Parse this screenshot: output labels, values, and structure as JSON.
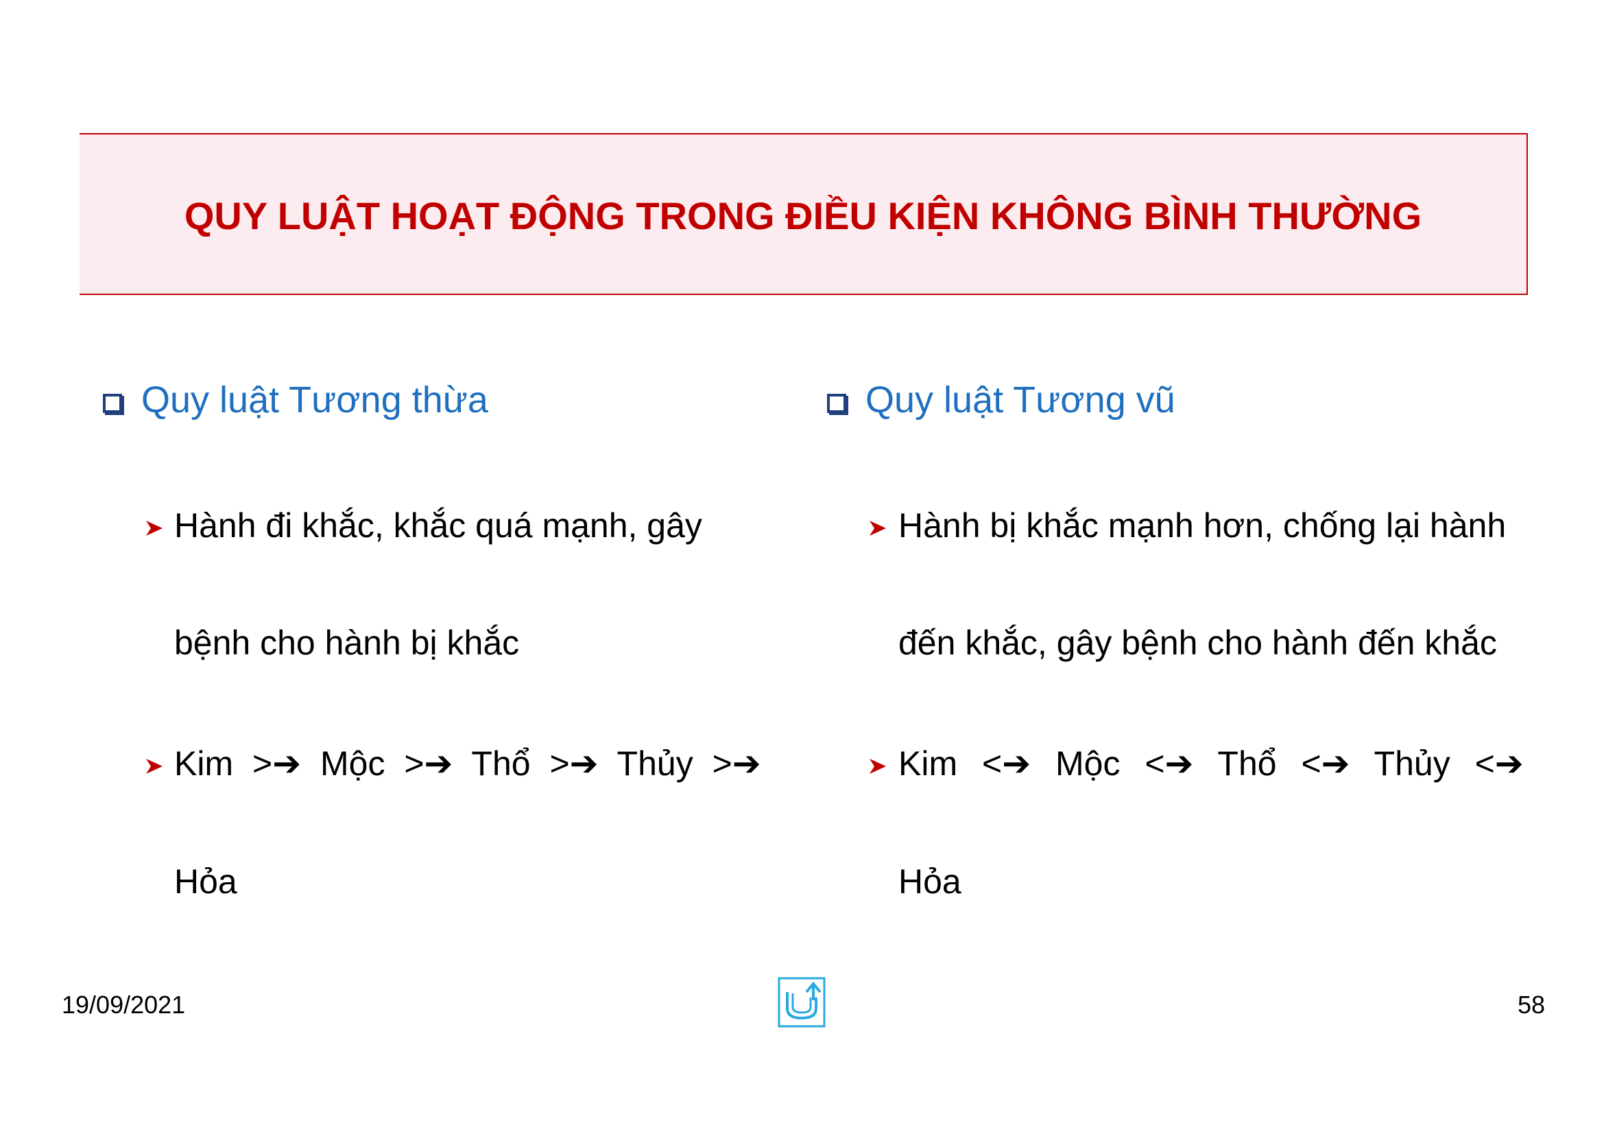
{
  "slide": {
    "title": "QUY LUẬT HOẠT ĐỘNG TRONG ĐIỀU KIỆN KHÔNG BÌNH THƯỜNG"
  },
  "left_column": {
    "heading": "Quy luật Tương thừa",
    "bullet_1_line_1": "Hành đi khắc, khắc quá mạnh, gây",
    "bullet_1_line_2": "bệnh cho hành bị khắc",
    "bullet_2_line_1": "Kim >➔ Mộc >➔ Thổ >➔ Thủy >➔",
    "bullet_2_line_2": "Hỏa"
  },
  "right_column": {
    "heading": "Quy luật Tương vũ",
    "bullet_1_line_1": "Hành bị khắc mạnh hơn, chống lại hành",
    "bullet_1_line_2": "đến khắc, gây bệnh cho hành đến khắc",
    "bullet_2_line_1": "Kim <➔ Mộc <➔ Thổ <➔ Thủy <➔",
    "bullet_2_line_2": "Hỏa"
  },
  "footer": {
    "date": "19/09/2021",
    "page_number": "58"
  },
  "colors": {
    "title_red": "#c00000",
    "title_bg": "#fdecef",
    "heading_blue": "#1f6fbf",
    "bullet_red": "#c00000",
    "logo_blue": "#29a9e0"
  },
  "icons": {
    "heading_bullet": "square-bullet-icon",
    "item_bullet": "arrowhead-bullet-icon",
    "footer_logo": "u-logo-icon"
  }
}
